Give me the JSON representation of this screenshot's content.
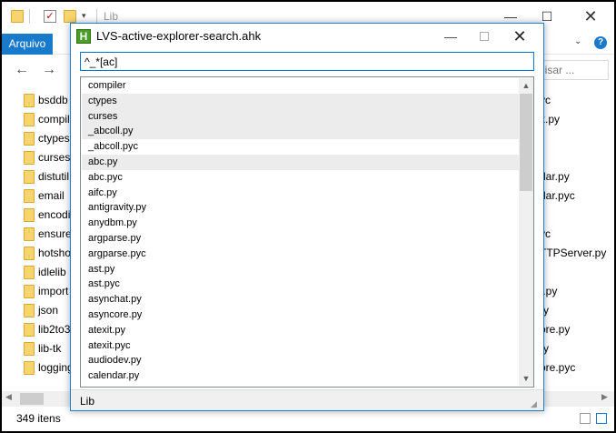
{
  "explorer": {
    "title": "Lib",
    "ribbon_tab": "Arquivo",
    "search_placeholder": "uisar ...",
    "status_count": "349 itens",
    "left_items": [
      "bsddb",
      "compil",
      "ctypes",
      "curses",
      "distutil",
      "email",
      "encodi",
      "ensure",
      "hotsho",
      "idlelib",
      "import",
      "json",
      "lib2to3",
      "lib-tk",
      "logging"
    ],
    "right_items": [
      "yc",
      "x.py",
      "",
      "",
      "dar.py",
      "dar.pyc",
      "",
      "yc",
      "TTPServer.py",
      "",
      "t.py",
      "ry",
      "ore.py",
      "ry",
      "ore.pyc"
    ]
  },
  "dialog": {
    "title": "LVS-active-explorer-search.ahk",
    "icon_letter": "H",
    "search_value": "^_*[ac]",
    "status_text": "Lib",
    "items": [
      {
        "label": "compiler",
        "selected": false
      },
      {
        "label": "ctypes",
        "selected": true
      },
      {
        "label": "curses",
        "selected": true
      },
      {
        "label": "_abcoll.py",
        "selected": true
      },
      {
        "label": "_abcoll.pyc",
        "selected": false
      },
      {
        "label": "abc.py",
        "selected": true
      },
      {
        "label": "abc.pyc",
        "selected": false
      },
      {
        "label": "aifc.py",
        "selected": false
      },
      {
        "label": "antigravity.py",
        "selected": false
      },
      {
        "label": "anydbm.py",
        "selected": false
      },
      {
        "label": "argparse.py",
        "selected": false
      },
      {
        "label": "argparse.pyc",
        "selected": false
      },
      {
        "label": "ast.py",
        "selected": false
      },
      {
        "label": "ast.pyc",
        "selected": false
      },
      {
        "label": "asynchat.py",
        "selected": false
      },
      {
        "label": "asyncore.py",
        "selected": false
      },
      {
        "label": "atexit.py",
        "selected": false
      },
      {
        "label": "atexit.pyc",
        "selected": false
      },
      {
        "label": "audiodev.py",
        "selected": false
      },
      {
        "label": "calendar.py",
        "selected": false
      }
    ]
  },
  "colors": {
    "accent": "#1979ca",
    "folder": "#f7d56e",
    "selection": "#ececec",
    "dialog_border": "#1883d7"
  }
}
